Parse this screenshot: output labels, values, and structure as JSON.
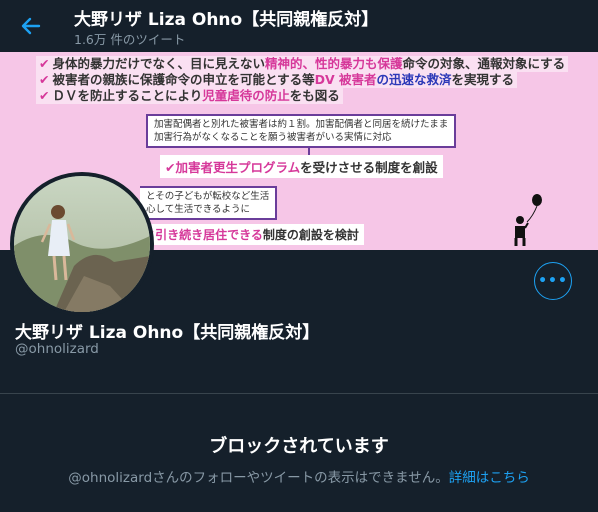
{
  "header": {
    "title": "大野リザ Liza Ohno【共同親権反対】",
    "tweet_count": "1.6万 件のツイート"
  },
  "banner": {
    "line1_a": "身体的暴力だけでなく、目に見えない",
    "line1_b": "精神的、性的暴力も保護",
    "line1_c": "命令の対象、通報対象にする",
    "line2_a": "被害者の親族に保護命令の申立を可能とする等",
    "line2_b": "DV 被害者",
    "line2_c": "の迅速な救済",
    "line2_d": "を実現する",
    "line3_a": "ＤＶを防止することにより",
    "line3_b": "児童虐待の防止",
    "line3_c": "をも図る",
    "box1_l1": "加害配偶者と別れた被害者は約１割。加害配偶者と同居を続けたまま",
    "box1_l2": "加害行為がなくなることを願う被害者がいる実情に対応",
    "program_a": "加害者更生プログラム",
    "program_b": "を受けさせる制度を創設",
    "box2_l1": "とその子どもが転校など生活",
    "box2_l2": "心して生活できるように",
    "bottom_a": "引き続き居住できる",
    "bottom_b": "制度の創設を検討"
  },
  "profile": {
    "name": "大野リザ Liza Ohno【共同親権反対】",
    "handle": "@ohnolizard",
    "more_label": "•••"
  },
  "blocked": {
    "title": "ブロックされています",
    "message": "@ohnolizardさんのフォローやツイートの表示はできません。",
    "link": "詳細はこちら"
  },
  "colors": {
    "background": "#15202b",
    "accent": "#1da1f2",
    "muted": "#8899a6",
    "banner_pink": "#f6c6e7"
  }
}
